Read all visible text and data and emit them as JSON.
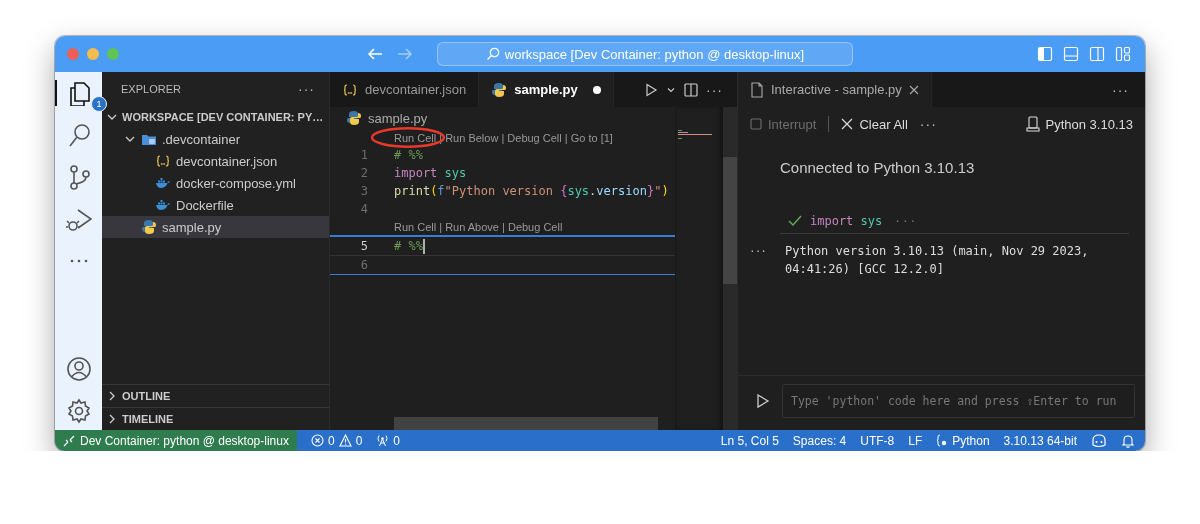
{
  "window": {
    "title": "workspace [Dev Container: python @ desktop-linux]"
  },
  "activity_bar": {
    "items": [
      {
        "selected": true,
        "badge": "1"
      },
      {
        "selected": false
      },
      {
        "selected": false
      },
      {
        "selected": false
      },
      {
        "selected": false
      }
    ],
    "bottom_items": [
      {
        "selected": false
      },
      {
        "selected": false
      }
    ]
  },
  "sidebar": {
    "title": "EXPLORER",
    "more": "···",
    "section": {
      "label": "WORKSPACE [DEV CONTAINER: PY…",
      "expanded": true,
      "children": [
        {
          "label": ".devcontainer",
          "kind": "folder",
          "expanded": true,
          "selected": false,
          "children": [
            {
              "label": "devcontainer.json",
              "kind": "json",
              "selected": false
            },
            {
              "label": "docker-compose.yml",
              "kind": "docker",
              "selected": false
            },
            {
              "label": "Dockerfile",
              "kind": "docker",
              "selected": false
            }
          ]
        },
        {
          "label": "sample.py",
          "kind": "python",
          "selected": true
        }
      ]
    },
    "collapsed_sections": [
      {
        "label": "OUTLINE",
        "expanded": false
      },
      {
        "label": "TIMELINE",
        "expanded": false
      }
    ]
  },
  "editor": {
    "tabs": [
      {
        "label": "devcontainer.json",
        "kind": "json",
        "selected": false,
        "modified": false
      },
      {
        "label": "sample.py",
        "kind": "python",
        "selected": true,
        "modified": true
      }
    ],
    "more": "···",
    "breadcrumb": "sample.py",
    "lines": [
      {
        "number": "1",
        "code_lens": "Run Cell | Run Below | Debug Cell | Go to [1]",
        "active": false,
        "tokens": [
          {
            "kind": "comment",
            "text": "# %%"
          }
        ]
      },
      {
        "number": "2",
        "active": false,
        "tokens": [
          {
            "kind": "keyword",
            "text": "import"
          },
          {
            "kind": "module",
            "text": "sys"
          }
        ]
      },
      {
        "number": "3",
        "active": false,
        "tokens": [
          {
            "kind": "function",
            "text": "print"
          },
          {
            "kind": "bracket",
            "text": "("
          },
          {
            "kind": "prefix",
            "text": "f"
          },
          {
            "kind": "string",
            "text": "\"Python version "
          },
          {
            "kind": "brace",
            "text": "{"
          },
          {
            "kind": "module",
            "text": "sys"
          },
          {
            "kind": "plain",
            "text": "."
          },
          {
            "kind": "attribute",
            "text": "version"
          },
          {
            "kind": "brace",
            "text": "}"
          },
          {
            "kind": "string",
            "text": "\""
          },
          {
            "kind": "bracket",
            "text": ")"
          }
        ]
      },
      {
        "number": "4",
        "active": false
      },
      {
        "number": "5",
        "code_lens": "Run Cell | Run Above | Debug Cell",
        "active": true,
        "tokens": [
          {
            "kind": "comment",
            "text": "# %%"
          }
        ]
      },
      {
        "number": "6",
        "active": false
      }
    ]
  },
  "interactive": {
    "tab": {
      "label": "Interactive - sample.py",
      "selected": true
    },
    "more": "···",
    "toolbar": {
      "more": "···",
      "interrupt": {
        "label": "Interrupt",
        "disabled": true
      },
      "clear": {
        "label": "Clear All",
        "disabled": false
      },
      "kernel": "Python 3.10.13"
    },
    "message": "Connected to Python 3.10.13",
    "cell": {
      "succeeded": true,
      "tokens": [
        {
          "kind": "keyword",
          "text": "import"
        },
        {
          "kind": "module",
          "text": "sys"
        }
      ],
      "collapsed_marker": "···",
      "output_menu": "···",
      "output": "Python version 3.10.13 (main, Nov 29 2023, 04:41:26) [GCC 12.2.0]"
    },
    "input": {
      "placeholder": "Type 'python' code here and press ⇧Enter to run"
    }
  },
  "status_bar": {
    "remote": "Dev Container: python @ desktop-linux",
    "errors": "0",
    "warnings": "0",
    "ports": "0",
    "right": [
      {
        "kind": "text",
        "label": "Ln 5, Col 5"
      },
      {
        "kind": "text",
        "label": "Spaces: 4"
      },
      {
        "kind": "text",
        "label": "UTF-8"
      },
      {
        "kind": "text",
        "label": "LF"
      },
      {
        "kind": "language",
        "label": "Python"
      },
      {
        "kind": "text",
        "label": "3.10.13 64-bit"
      },
      {
        "kind": "copilot"
      },
      {
        "kind": "bell"
      }
    ]
  }
}
